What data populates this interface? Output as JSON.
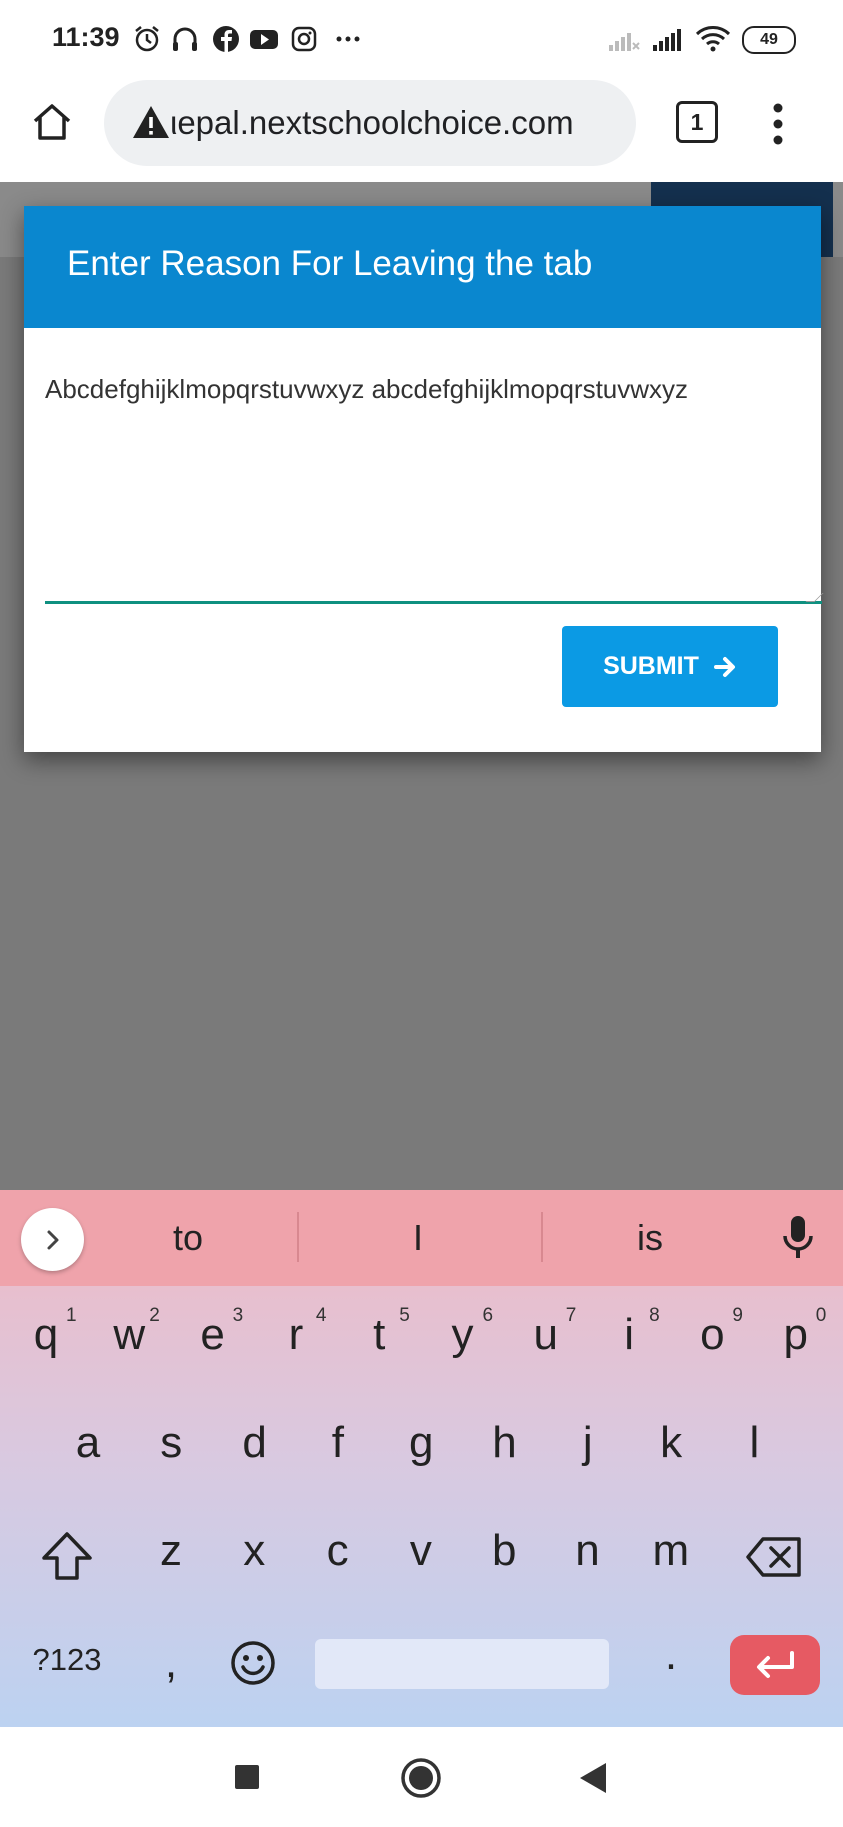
{
  "status_bar": {
    "time": "11:39",
    "battery": "49"
  },
  "browser": {
    "url": "ιepal.nextschoolchoice.com",
    "tab_count": "1"
  },
  "dialog": {
    "title": "Enter Reason For Leaving the tab",
    "reason_value": "Abcdefghijklmopqrstuvwxyz abcdefghijklmopqrstuvwxyz",
    "submit_label": "SUBMIT"
  },
  "keyboard": {
    "suggestions": [
      "to",
      "I",
      "is"
    ],
    "row1": [
      "q",
      "w",
      "e",
      "r",
      "t",
      "y",
      "u",
      "i",
      "o",
      "p"
    ],
    "row1_hints": [
      "1",
      "2",
      "3",
      "4",
      "5",
      "6",
      "7",
      "8",
      "9",
      "0"
    ],
    "row2": [
      "a",
      "s",
      "d",
      "f",
      "g",
      "h",
      "j",
      "k",
      "l"
    ],
    "row3": [
      "z",
      "x",
      "c",
      "v",
      "b",
      "n",
      "m"
    ],
    "symbols_label": "?123",
    "comma": ",",
    "period": "."
  },
  "icons": {
    "status": [
      "alarm-icon",
      "headphones-icon",
      "facebook-icon",
      "youtube-icon",
      "instagram-icon",
      "more-notifications-icon",
      "signal-no-service-icon",
      "signal-icon",
      "wifi-icon"
    ],
    "browser": [
      "home-icon",
      "warning-icon",
      "tabs-icon",
      "menu-dots-icon"
    ],
    "keyboard": [
      "chevron-right-icon",
      "microphone-icon",
      "shift-icon",
      "backspace-icon",
      "emoji-icon",
      "enter-icon"
    ],
    "nav": [
      "recents-icon",
      "home-circle-icon",
      "back-icon"
    ]
  },
  "colors": {
    "dialog_header": "#0a87cf",
    "submit": "#0b9ae4",
    "focus_underline": "#0f9080",
    "enter_key": "#e65a63"
  }
}
